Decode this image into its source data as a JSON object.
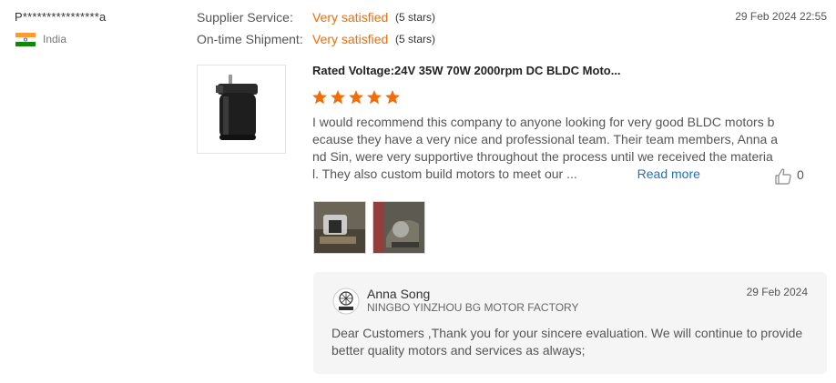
{
  "reviewer": {
    "name": "P****************a",
    "country": "India",
    "date": "29 Feb 2024 22:55"
  },
  "ratings": [
    {
      "label": "Supplier Service:",
      "value": "Very satisfied",
      "stars": "(5 stars)"
    },
    {
      "label": "On-time Shipment:",
      "value": "Very satisfied",
      "stars": "(5 stars)"
    }
  ],
  "product": {
    "title": "Rated Voltage:24V 35W 70W 2000rpm DC BLDC Moto...",
    "star_rating": 5,
    "review_text": "I would recommend this company to anyone looking for very good BLDC motors because they have a very nice and professional team. Their team members, Anna and Sin, were very supportive throughout the process until we received the material. They also custom build motors to meet our ...",
    "read_more": "Read more",
    "likes": "0"
  },
  "reply": {
    "name": "Anna Song",
    "company": "NINGBO YINZHOU BG MOTOR FACTORY",
    "date": "29 Feb 2024",
    "text": "Dear Customers ,Thank you for your sincere evaluation. We will continue to provide better quality motors and services as always;"
  },
  "colors": {
    "accent": "#f26d07",
    "link": "#1b6fc9",
    "reply_bg": "#f5f5f5"
  }
}
